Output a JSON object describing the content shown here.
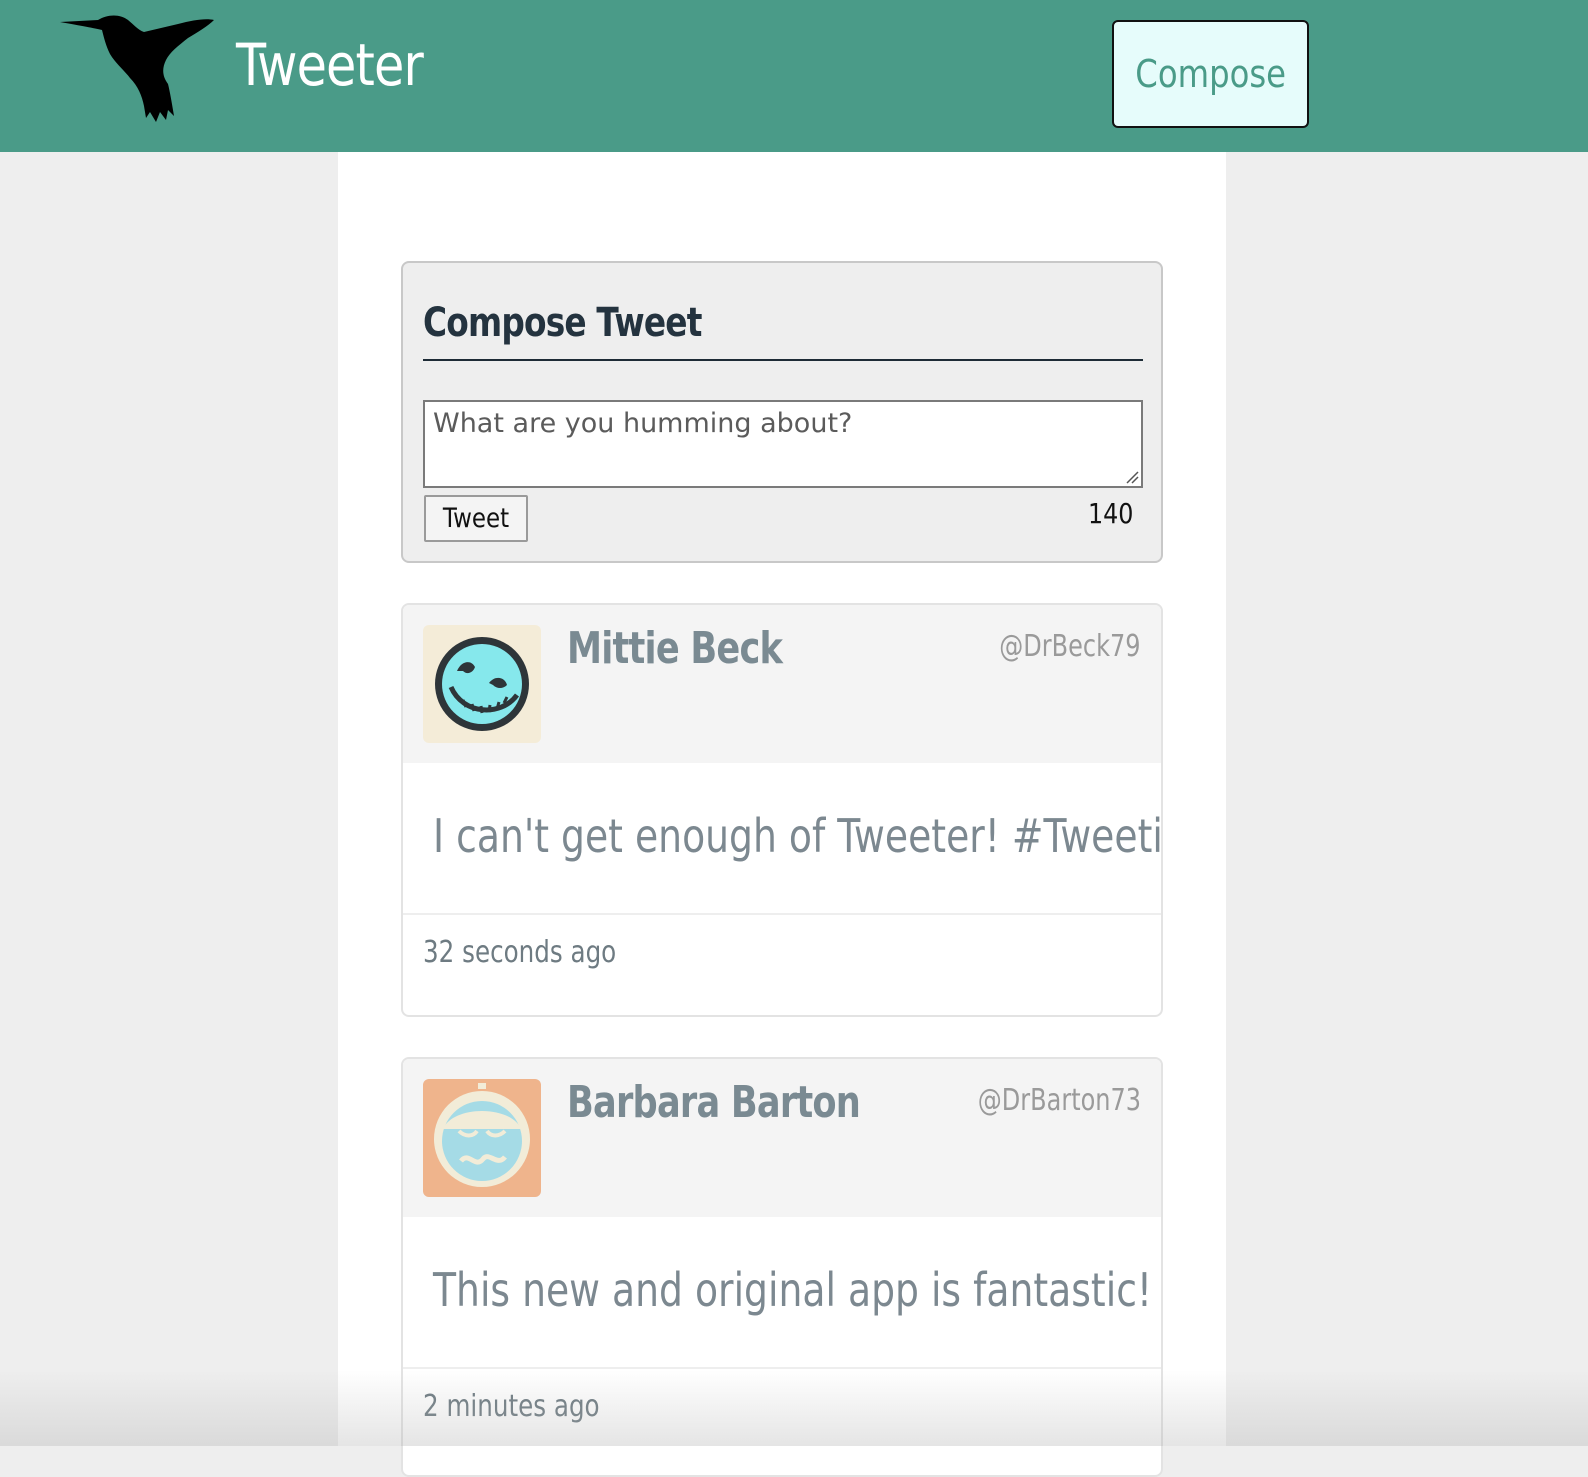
{
  "navbar": {
    "brand": "Tweeter",
    "compose_label": "Compose",
    "logo_icon": "hummingbird-icon"
  },
  "composer": {
    "title": "Compose Tweet",
    "placeholder": "What are you humming about?",
    "submit_label": "Tweet",
    "char_count": "140"
  },
  "tweets": [
    {
      "name": "Mittie Beck",
      "handle": "@DrBeck79",
      "text": "I can't get enough of Tweeter! #Tweetin",
      "time": "32 seconds ago",
      "avatar_icon": "robot-face-avatar"
    },
    {
      "name": "Barbara Barton",
      "handle": "@DrBarton73",
      "text": "This new and original app is fantastic!",
      "time": "2 minutes ago",
      "avatar_icon": "sleepy-robot-avatar"
    }
  ],
  "colors": {
    "navbar": "#4a9b88",
    "compose_button_bg": "#e6fcfb",
    "page_bg": "#eeeeee"
  }
}
